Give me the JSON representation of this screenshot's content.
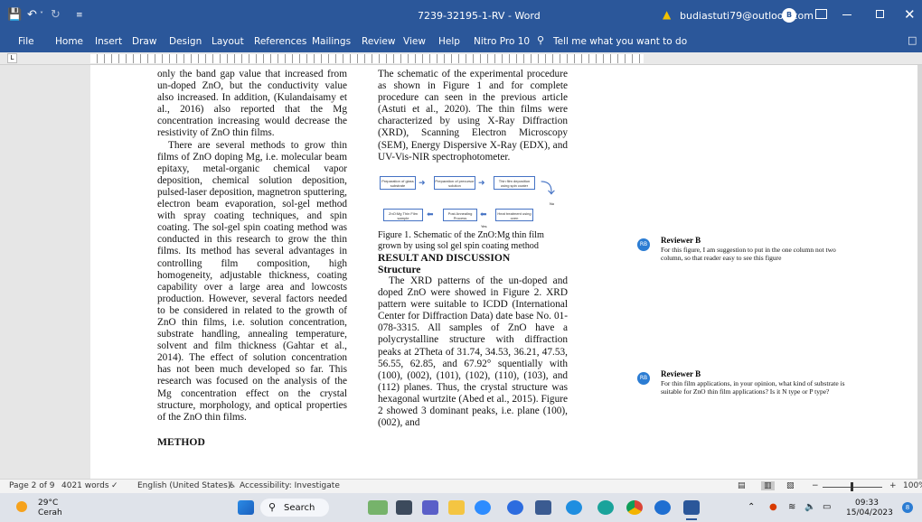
{
  "window": {
    "title": "7239-32195-1-RV  -  Word",
    "account_email": "budiastuti79@outlook.com",
    "account_initial": "B",
    "warning_icon": "warning-icon",
    "colors": {
      "titlebar": "#2b579a",
      "accent": "#2b7cd3"
    }
  },
  "ribbon": {
    "tabs": [
      "File",
      "Home",
      "Insert",
      "Draw",
      "Design",
      "Layout",
      "References",
      "Mailings",
      "Review",
      "View",
      "Help",
      "Nitro Pro 10"
    ],
    "tell_me": "Tell me what you want to do"
  },
  "document": {
    "left_column": {
      "p1": "only the band gap value that increased from un-doped ZnO, but the conductivity value also increased. In addition, (Kulandaisamy et al., 2016) also reported that the Mg concentration increasing would decrease the resistivity of ZnO thin films.",
      "p2": "There are several methods to grow thin films of ZnO doping Mg, i.e. molecular beam epitaxy, metal-organic chemical vapor deposition, chemical solution deposition, pulsed-laser deposition, magnetron sputtering, electron beam evaporation, sol-gel method with spray coating techniques, and spin coating. The sol-gel spin coating method was conducted in this research to grow the thin films. Its method has several advantages in controlling film composition, high homogeneity, adjustable thickness, coating capability over a large area and lowcosts production. However, several factors needed to be considered in related to the growth of ZnO thin films, i.e. solution concentration, substrate handling, annealing temperature, solvent and film thickness (Gahtar et al., 2014). The effect of solution concentration has not been much developed so far. This research was focused on the analysis of the Mg concentration effect on the crystal structure, morphology, and optical properties of the ZnO thin films.",
      "heading": "METHOD"
    },
    "right_column": {
      "p1": "The schematic of the experimental procedure as shown in Figure 1 and for complete procedure can seen in the previous article (Astuti et al., 2020). The thin films were characterized by using X-Ray Diffraction (XRD), Scanning Electron Microscopy (SEM), Energy Dispersive X-Ray (EDX), and UV-Vis-NIR spectrophotometer.",
      "caption": "Figure 1. Schematic of the ZnO:Mg thin film grown by using sol gel spin coating method",
      "heading1": "RESULT AND DISCUSSION",
      "heading2": "Structure",
      "p2": "The XRD patterns of the un-doped and doped ZnO were showed in Figure 2. XRD pattern were suitable to ICDD (International Center for Diffraction Data) date base No. 01-078-3315. All samples of ZnO have a polycrystalline structure with diffraction peaks at 2Theta of 31.74, 34.53, 36.21, 47.53, 56.55, 62.85, and 67.92° squentially with (100), (002), (101), (102), (110), (103), and (112) planes. Thus, the crystal structure was hexagonal wurtzite (Abed et al., 2015). Figure 2 showed 3 dominant peaks, i.e. plane (100), (002), and"
    },
    "figure": {
      "box1": "Preparation of glass substrate",
      "box2": "Preparation of precursor solution",
      "box3": "Thin film deposition using spin coater",
      "box4": "Heat treatment using oven",
      "box5": "Post Annealing Process",
      "box6": "ZnO:Mg Thin Film sample",
      "no": "No",
      "yes": "Yes"
    }
  },
  "comments": [
    {
      "initials": "RB",
      "author": "Reviewer B",
      "text": "For this figure, I am suggestion to put in the one column not two column, so that reader easy to see this figure"
    },
    {
      "initials": "RB",
      "author": "Reviewer B",
      "text": "For thin film applications, in your opinion, what kind of substrate is suitable for ZnO thin film applications? Is it N type or P type?"
    }
  ],
  "statusbar": {
    "page": "Page 2 of 9",
    "words": "4021 words",
    "language": "English (United States)",
    "accessibility": "Accessibility: Investigate",
    "zoom": "100%"
  },
  "taskbar": {
    "temperature": "29°C",
    "weather": "Cerah",
    "search": "Search",
    "time": "09:33",
    "date": "15/04/2023",
    "notification_count": "8"
  }
}
